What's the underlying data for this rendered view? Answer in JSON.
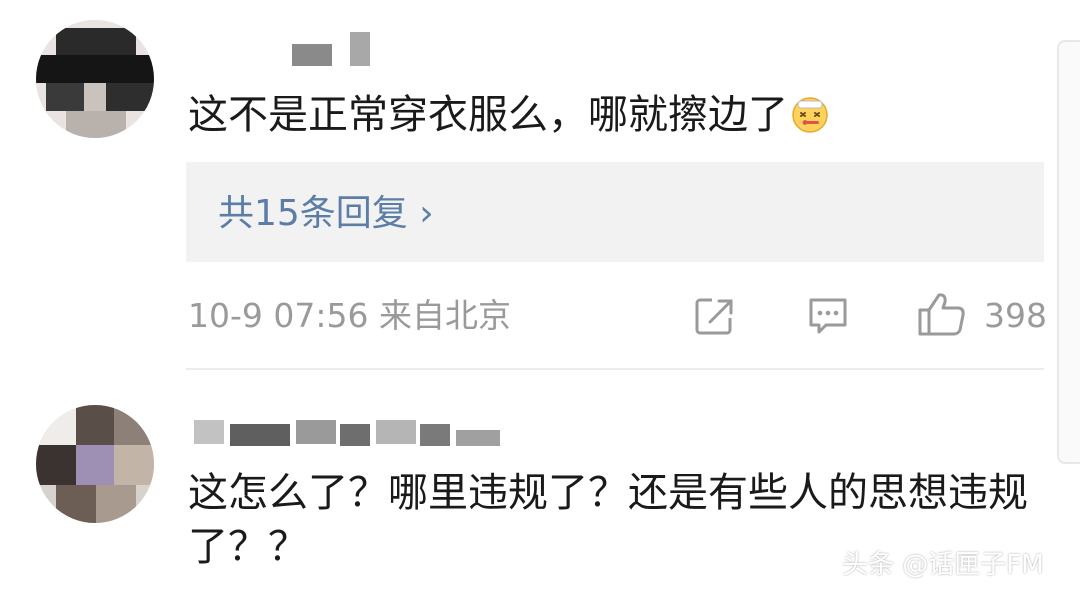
{
  "comments": [
    {
      "username": "",
      "text": "这不是正常穿衣服么，哪就擦边了",
      "emoji": "dizzy-face-thermometer-icon",
      "reply_link": "共15条回复 ›",
      "meta": "10-9 07:56 来自北京",
      "like_count": "398"
    },
    {
      "username": "",
      "text": "这怎么了？哪里违规了？还是有些人的思想违规了？？"
    }
  ],
  "watermark": "头条 @话匣子FM",
  "colors": {
    "link": "#5b7da8",
    "meta": "#9a9a9a",
    "reply_bg": "#f2f2f2"
  }
}
